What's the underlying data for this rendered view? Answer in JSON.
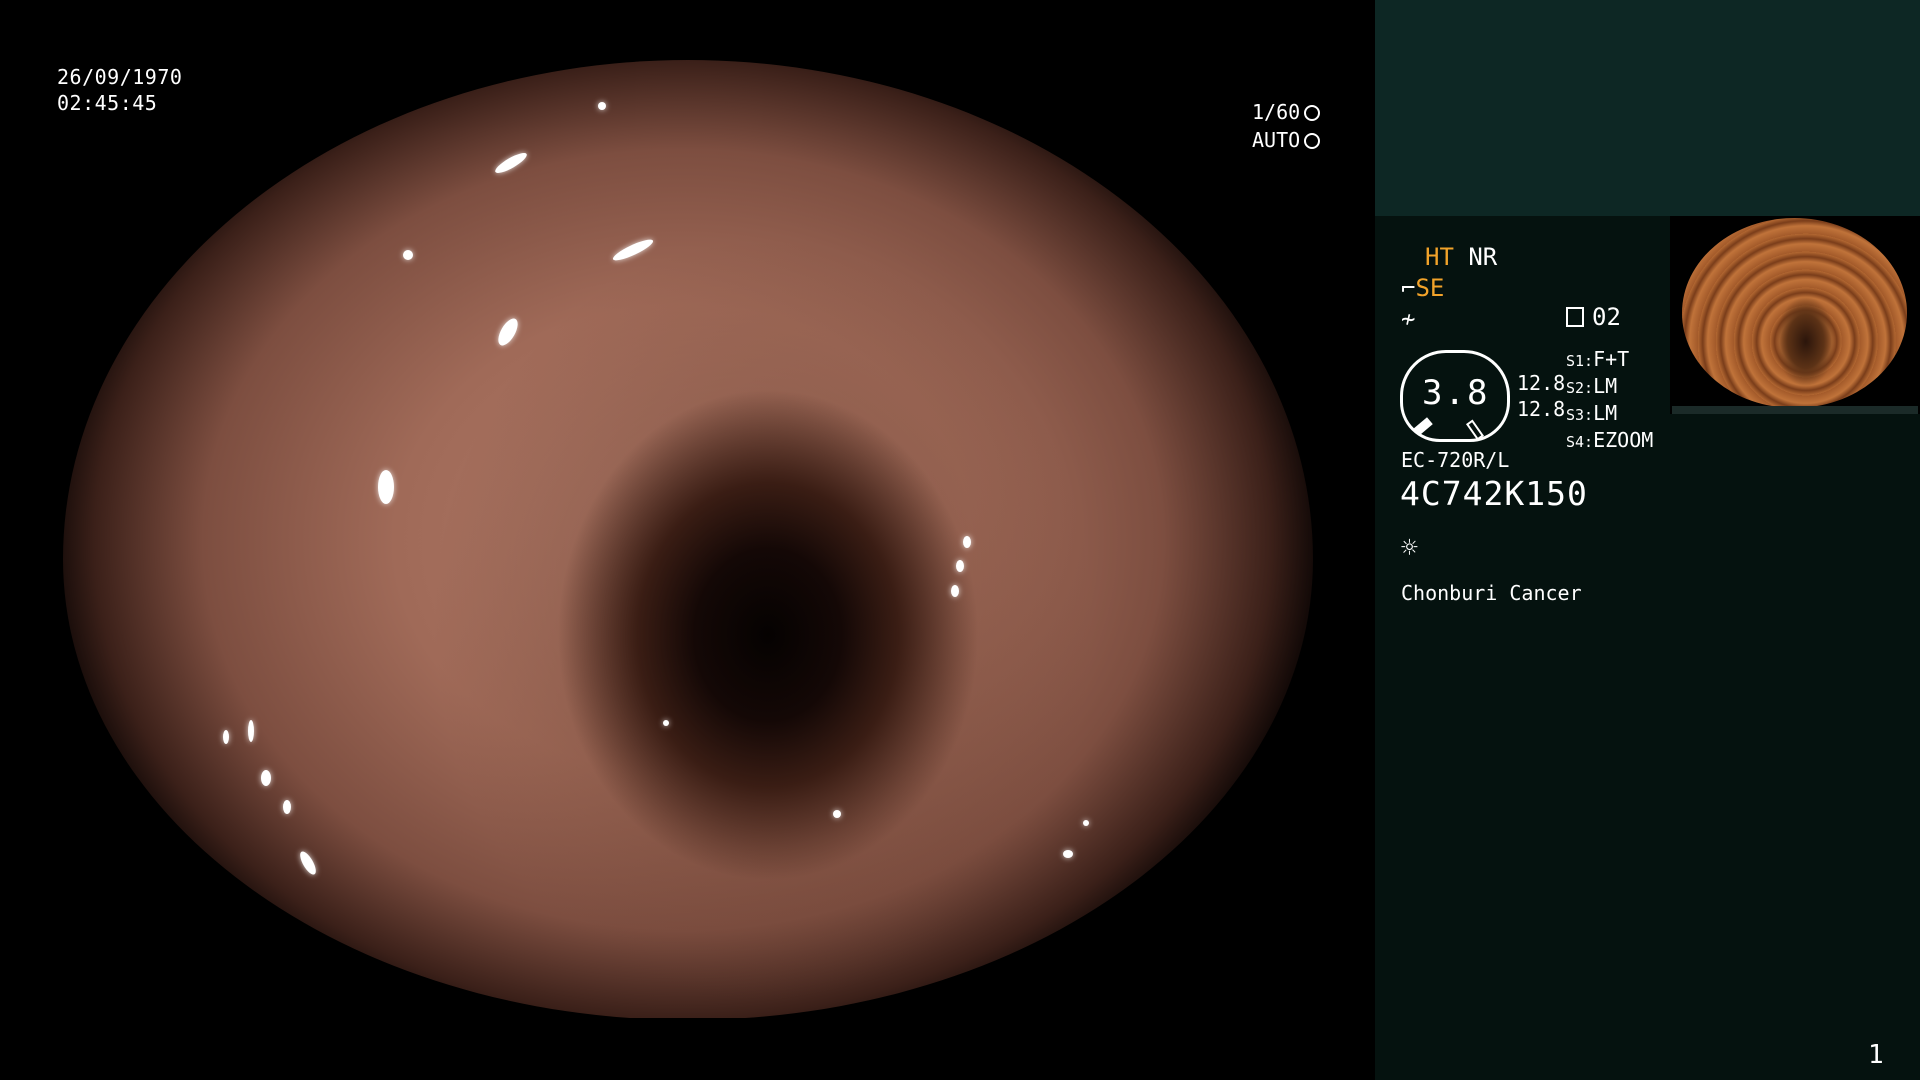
{
  "overlay": {
    "date": "26/09/1970",
    "time": "02:45:45",
    "shutter": "1/60",
    "iris": "AUTO"
  },
  "panel": {
    "ht_label": "HT",
    "nr_label": "NR",
    "se_label": "SE",
    "se_prefix": "⌐",
    "f_symbol": "≁",
    "preset": "02",
    "dial_value": "3.8",
    "value_1": "12.8",
    "value_2": "12.8",
    "switches": [
      {
        "key": "S1:",
        "value": "F+T"
      },
      {
        "key": "S2:",
        "value": "LM"
      },
      {
        "key": "S3:",
        "value": "LM"
      },
      {
        "key": "S4:",
        "value": "EZOOM"
      }
    ],
    "scope_model": "EC-720R/L",
    "serial": "4C742K150",
    "light_icon": "☼",
    "institution": "Chonburi Cancer",
    "page_number": "1"
  },
  "colors": {
    "accent_orange": "#f2a32a",
    "panel_bg": "#05120f",
    "panel_top_bg": "#0d2724"
  }
}
